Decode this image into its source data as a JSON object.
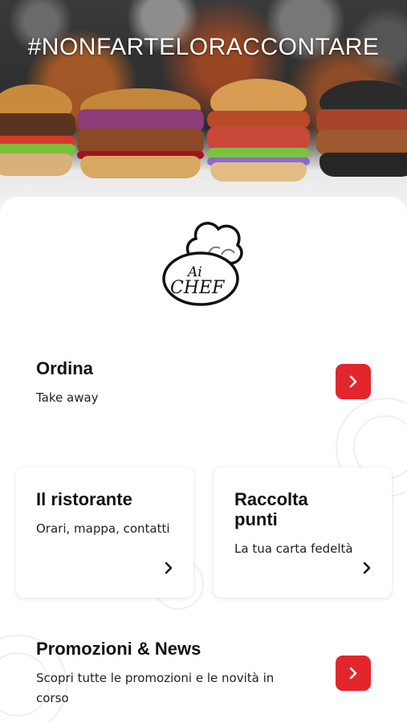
{
  "hero": {
    "hashtag": "#NONFARTELORACCONTARE"
  },
  "brand": {
    "logo_text_line1": "Ai",
    "logo_text_line2": "CHEF"
  },
  "order": {
    "title": "Ordina",
    "subtitle": "Take away",
    "icon": "chevron-right-icon"
  },
  "cards": [
    {
      "title": "Il ristorante",
      "subtitle": "Orari, mappa, contatti",
      "icon": "chevron-right-icon"
    },
    {
      "title_line1": "Raccolta",
      "title_line2": "punti",
      "subtitle": "La tua carta fedeltà",
      "icon": "chevron-right-icon"
    }
  ],
  "promo": {
    "title": "Promozioni & News",
    "subtitle_line1": "Scopri tutte le promozioni e le novità in",
    "subtitle_line2": "corso",
    "icon": "chevron-right-icon"
  },
  "colors": {
    "accent": "#e3262b",
    "text": "#111111",
    "card_bg": "#ffffff"
  }
}
